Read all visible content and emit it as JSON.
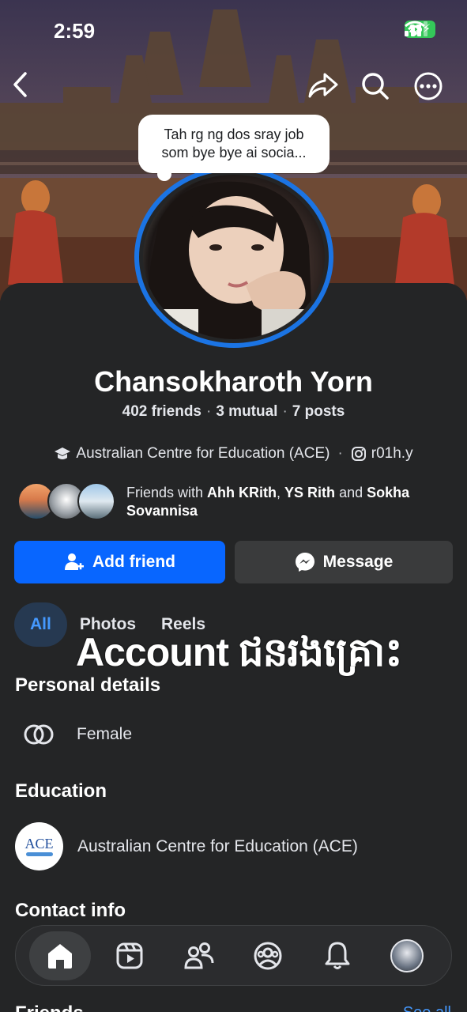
{
  "status": {
    "time": "2:59",
    "battery": "25"
  },
  "topnav": {
    "back_icon": "chevron-left-icon",
    "share_icon": "share-icon",
    "search_icon": "search-icon",
    "more_icon": "more-icon"
  },
  "note": {
    "line1": "Tah rg ng dos sray job",
    "line2": "som bye bye ai socia..."
  },
  "profile": {
    "name": "Chansokharoth Yorn",
    "friends": "402 friends",
    "mutual": "3 mutual",
    "posts": "7 posts",
    "school": "Australian Centre for Education (ACE)",
    "instagram": "r01h.y"
  },
  "mutual_friends": {
    "prefix": "Friends with",
    "friend1": "Ahh KRith",
    "friend2": "YS Rith",
    "and": "and",
    "friend3": "Sokha Sovannisa"
  },
  "actions": {
    "add_friend": "Add friend",
    "message": "Message"
  },
  "tabs": [
    {
      "label": "All",
      "active": true
    },
    {
      "label": "Photos",
      "active": false
    },
    {
      "label": "Reels",
      "active": false
    }
  ],
  "overlay": {
    "text": "Account ជនរងគ្រោះ"
  },
  "sections": {
    "personal_title": "Personal details",
    "gender": "Female",
    "education_title": "Education",
    "education_school": "Australian Centre for Education (ACE)",
    "ace_logo_text": "ACE",
    "contact_title": "Contact info",
    "friends_title": "Friends",
    "see_all": "See all"
  },
  "colors": {
    "accent": "#0866ff",
    "ring": "#1b74e4",
    "background": "#242526"
  }
}
